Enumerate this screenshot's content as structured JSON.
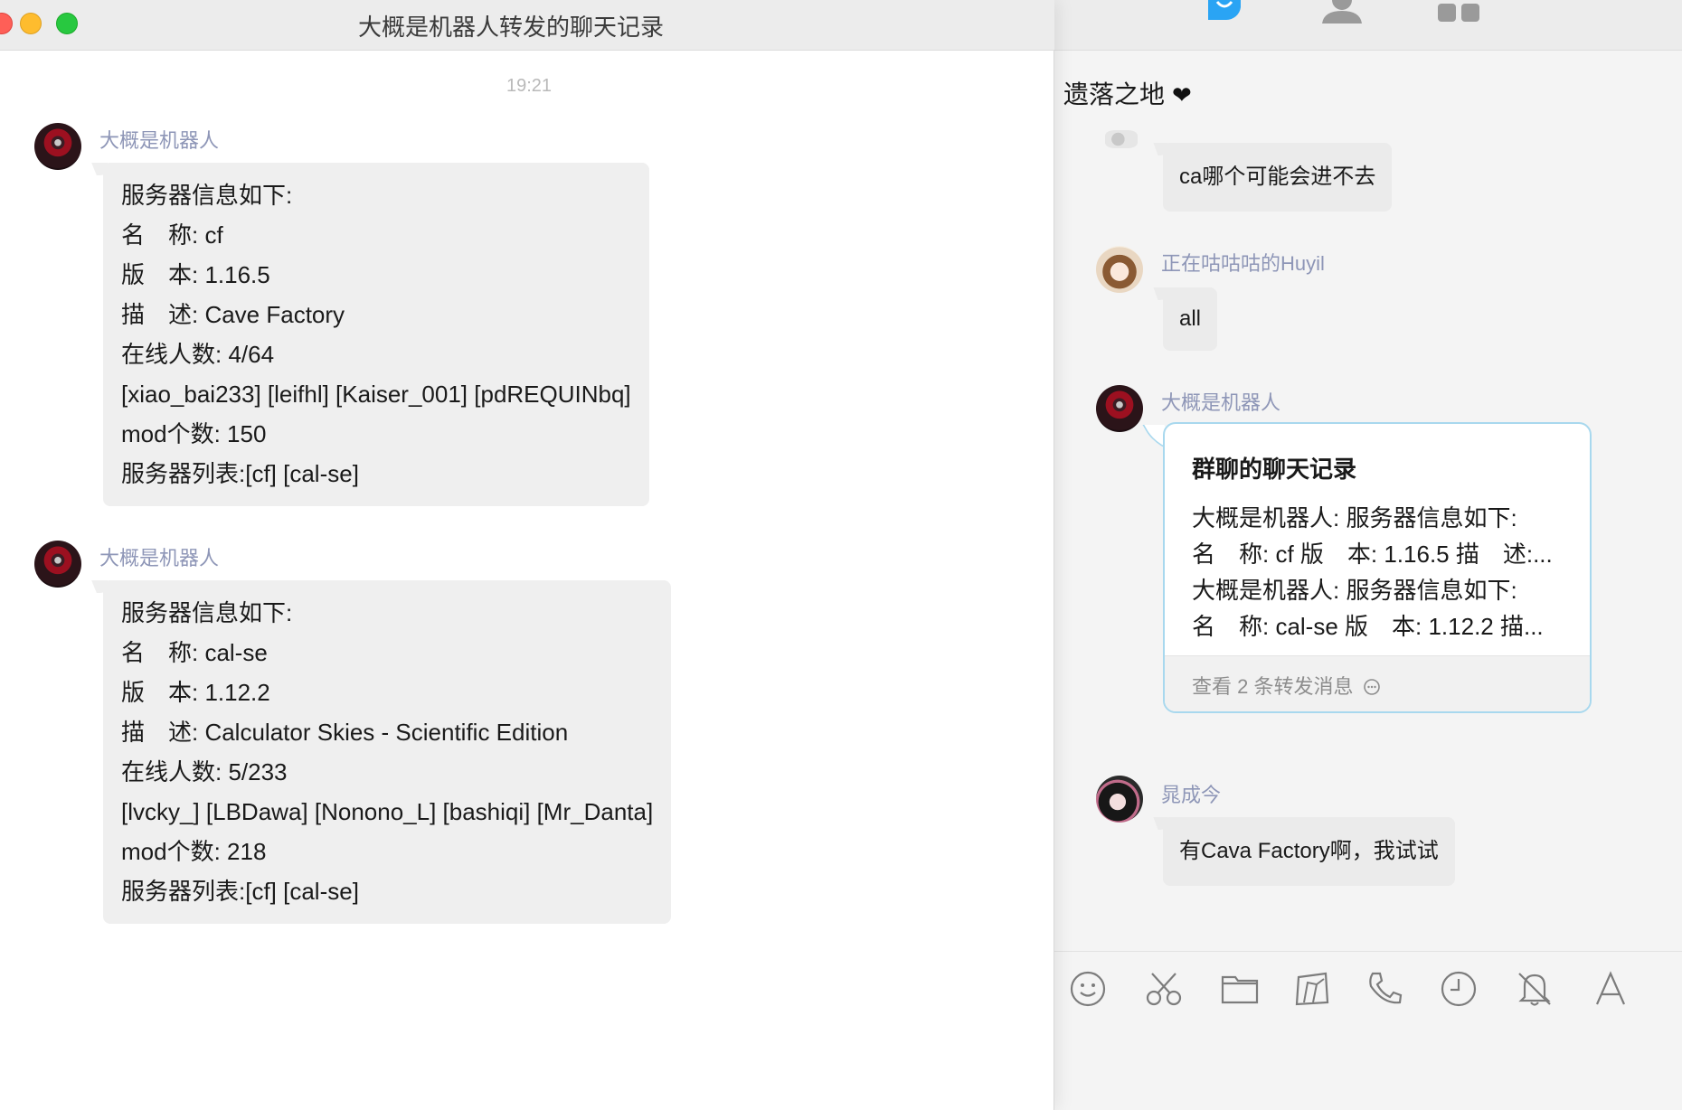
{
  "back_window": {
    "top_icons": [
      "chat-bubble-icon",
      "contacts-icon",
      "apps-icon"
    ],
    "title": "遗落之地",
    "title_icon": "heart-icon",
    "messages": [
      {
        "sender": "",
        "text": "ca哪个可能会进不去"
      },
      {
        "sender": "正在咕咕咕的Huyil",
        "text": "all"
      },
      {
        "sender": "大概是机器人",
        "forward": {
          "title": "群聊的聊天记录",
          "lines": [
            "大概是机器人: 服务器信息如下:",
            "名　称: cf 版　本: 1.16.5 描　述:...",
            "大概是机器人: 服务器信息如下:",
            "名　称: cal-se 版　本: 1.12.2 描..."
          ],
          "footer": "查看 2 条转发消息"
        }
      },
      {
        "sender": "晁成今",
        "text": "有Cava Factory啊，我试试"
      }
    ],
    "toolbar": [
      "emoji-icon",
      "scissors-icon",
      "folder-icon",
      "image-icon",
      "phone-icon",
      "clock-icon",
      "bell-off-icon",
      "font-icon"
    ]
  },
  "window": {
    "title": "大概是机器人转发的聊天记录",
    "traffic_lights": {
      "close": "#fe5f57",
      "minimize": "#febc2e",
      "zoom": "#28c840"
    },
    "timestamp": "19:21",
    "messages": [
      {
        "sender": "大概是机器人",
        "lines": [
          "服务器信息如下:",
          "名　称: cf",
          "版　本: 1.16.5",
          "描　述: Cave Factory",
          "在线人数: 4/64",
          "[xiao_bai233] [leifhl] [Kaiser_001] [pdREQUINbq]",
          "mod个数: 150",
          "服务器列表:[cf] [cal-se]"
        ]
      },
      {
        "sender": "大概是机器人",
        "lines": [
          "服务器信息如下:",
          "名　称: cal-se",
          "版　本: 1.12.2",
          "描　述: Calculator Skies - Scientific Edition",
          "在线人数: 5/233",
          "[lvcky_] [LBDawa] [Nonono_L] [bashiqi] [Mr_Danta]",
          "mod个数: 218",
          "服务器列表:[cf] [cal-se]"
        ]
      }
    ]
  }
}
